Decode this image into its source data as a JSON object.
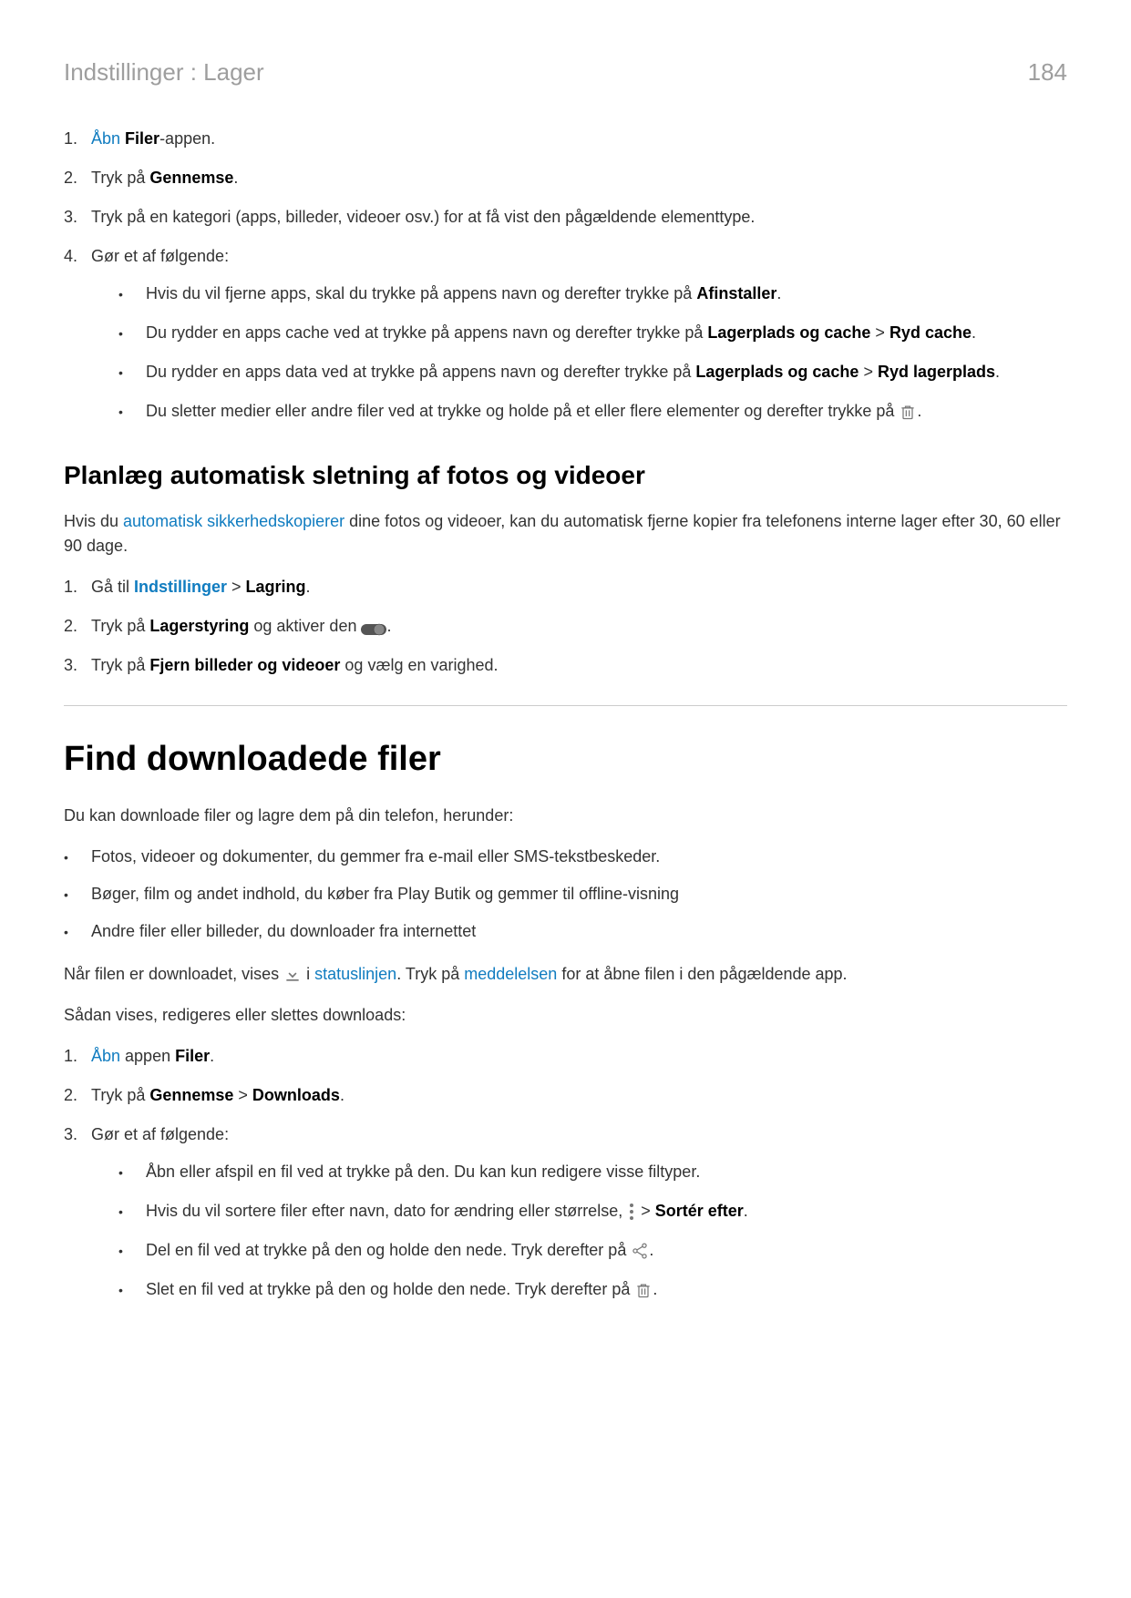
{
  "header": {
    "title": "Indstillinger : Lager",
    "pageNumber": "184"
  },
  "list1": {
    "items": [
      {
        "num": "1.",
        "parts": [
          {
            "type": "link",
            "text": "Åbn"
          },
          {
            "type": "text",
            "text": " "
          },
          {
            "type": "bold",
            "text": "Filer"
          },
          {
            "type": "text",
            "text": "-appen."
          }
        ]
      },
      {
        "num": "2.",
        "parts": [
          {
            "type": "text",
            "text": "Tryk på "
          },
          {
            "type": "bold",
            "text": "Gennemse"
          },
          {
            "type": "text",
            "text": "."
          }
        ]
      },
      {
        "num": "3.",
        "parts": [
          {
            "type": "text",
            "text": "Tryk på en kategori (apps, billeder, videoer osv.) for at få vist den pågældende elementtype."
          }
        ]
      },
      {
        "num": "4.",
        "parts": [
          {
            "type": "text",
            "text": "Gør et af følgende:"
          }
        ],
        "bullets": [
          [
            {
              "type": "text",
              "text": "Hvis du vil fjerne apps, skal du trykke på appens navn og derefter trykke på "
            },
            {
              "type": "bold",
              "text": "Afinstaller"
            },
            {
              "type": "text",
              "text": "."
            }
          ],
          [
            {
              "type": "text",
              "text": "Du rydder en apps cache ved at trykke på appens navn og derefter trykke på "
            },
            {
              "type": "bold",
              "text": "Lagerplads og cache"
            },
            {
              "type": "text",
              "text": " > "
            },
            {
              "type": "bold",
              "text": "Ryd cache"
            },
            {
              "type": "text",
              "text": "."
            }
          ],
          [
            {
              "type": "text",
              "text": "Du rydder en apps data ved at trykke på appens navn og derefter trykke på "
            },
            {
              "type": "bold",
              "text": "Lagerplads og cache"
            },
            {
              "type": "text",
              "text": " > "
            },
            {
              "type": "bold",
              "text": "Ryd lagerplads"
            },
            {
              "type": "text",
              "text": "."
            }
          ],
          [
            {
              "type": "text",
              "text": "Du sletter medier eller andre filer ved at trykke og holde på et eller flere elementer og derefter trykke på "
            },
            {
              "type": "icon",
              "icon": "trash"
            },
            {
              "type": "text",
              "text": "."
            }
          ]
        ]
      }
    ]
  },
  "h2a": "Planlæg automatisk sletning af fotos og videoer",
  "para1": {
    "parts": [
      {
        "type": "text",
        "text": "Hvis du "
      },
      {
        "type": "link",
        "text": "automatisk sikkerhedskopierer"
      },
      {
        "type": "text",
        "text": " dine fotos og videoer, kan du automatisk fjerne kopier fra telefonens interne lager efter 30, 60 eller 90 dage."
      }
    ]
  },
  "list2": {
    "items": [
      {
        "num": "1.",
        "parts": [
          {
            "type": "text",
            "text": "Gå til "
          },
          {
            "type": "linkbold",
            "text": "Indstillinger"
          },
          {
            "type": "text",
            "text": " > "
          },
          {
            "type": "bold",
            "text": "Lagring"
          },
          {
            "type": "text",
            "text": "."
          }
        ]
      },
      {
        "num": "2.",
        "parts": [
          {
            "type": "text",
            "text": "Tryk på "
          },
          {
            "type": "bold",
            "text": "Lagerstyring"
          },
          {
            "type": "text",
            "text": " og aktiver den "
          },
          {
            "type": "icon",
            "icon": "toggle"
          },
          {
            "type": "text",
            "text": "."
          }
        ]
      },
      {
        "num": "3.",
        "parts": [
          {
            "type": "text",
            "text": "Tryk på "
          },
          {
            "type": "bold",
            "text": "Fjern billeder og videoer"
          },
          {
            "type": "text",
            "text": " og vælg en varighed."
          }
        ]
      }
    ]
  },
  "h1": "Find downloadede filer",
  "para2": "Du kan downloade filer og lagre dem på din telefon, herunder:",
  "bullets2": [
    "Fotos, videoer og dokumenter, du gemmer fra e-mail eller SMS-tekstbeskeder.",
    "Bøger, film og andet indhold, du køber fra Play Butik og gemmer til offline-visning",
    "Andre filer eller billeder, du downloader fra internettet"
  ],
  "para3": {
    "parts": [
      {
        "type": "text",
        "text": "Når filen er downloadet, vises "
      },
      {
        "type": "icon",
        "icon": "download"
      },
      {
        "type": "text",
        "text": " i "
      },
      {
        "type": "link",
        "text": "statuslinjen"
      },
      {
        "type": "text",
        "text": ". Tryk på "
      },
      {
        "type": "link",
        "text": "meddelelsen"
      },
      {
        "type": "text",
        "text": " for at åbne filen i den pågældende app."
      }
    ]
  },
  "para4": "Sådan vises, redigeres eller slettes downloads:",
  "list3": {
    "items": [
      {
        "num": "1.",
        "parts": [
          {
            "type": "link",
            "text": "Åbn"
          },
          {
            "type": "text",
            "text": " appen "
          },
          {
            "type": "bold",
            "text": "Filer"
          },
          {
            "type": "text",
            "text": "."
          }
        ]
      },
      {
        "num": "2.",
        "parts": [
          {
            "type": "text",
            "text": "Tryk på "
          },
          {
            "type": "bold",
            "text": "Gennemse"
          },
          {
            "type": "text",
            "text": " > "
          },
          {
            "type": "bold",
            "text": "Downloads"
          },
          {
            "type": "text",
            "text": "."
          }
        ]
      },
      {
        "num": "3.",
        "parts": [
          {
            "type": "text",
            "text": "Gør et af følgende:"
          }
        ],
        "bullets": [
          [
            {
              "type": "text",
              "text": "Åbn eller afspil en fil ved at trykke på den. Du kan kun redigere visse filtyper."
            }
          ],
          [
            {
              "type": "text",
              "text": "Hvis du vil sortere filer efter navn, dato for ændring eller størrelse, "
            },
            {
              "type": "icon",
              "icon": "more"
            },
            {
              "type": "text",
              "text": " > "
            },
            {
              "type": "bold",
              "text": "Sortér efter"
            },
            {
              "type": "text",
              "text": "."
            }
          ],
          [
            {
              "type": "text",
              "text": "Del en fil ved at trykke på den og holde den nede. Tryk derefter på "
            },
            {
              "type": "icon",
              "icon": "share"
            },
            {
              "type": "text",
              "text": "."
            }
          ],
          [
            {
              "type": "text",
              "text": "Slet en fil ved at trykke på den og holde den nede. Tryk derefter på "
            },
            {
              "type": "icon",
              "icon": "trash"
            },
            {
              "type": "text",
              "text": "."
            }
          ]
        ]
      }
    ]
  }
}
